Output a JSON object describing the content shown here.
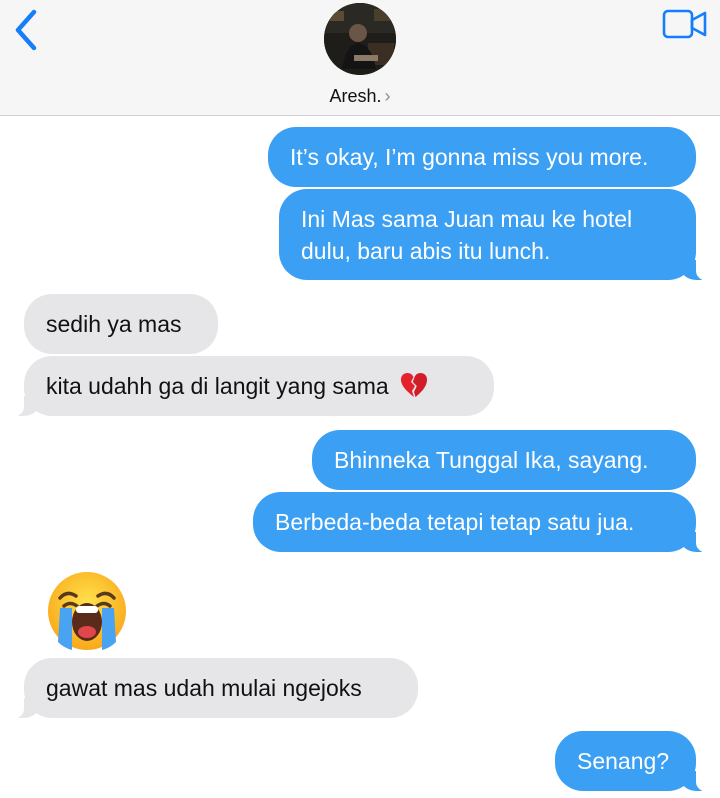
{
  "header": {
    "back_icon": "chevron-left-icon",
    "video_icon": "video-camera-icon",
    "contact_name": "Aresh.",
    "chevron": "›",
    "accent_color": "#147efb"
  },
  "messages": [
    {
      "direction": "outgoing",
      "text": "It’s okay, I’m gonna miss you more."
    },
    {
      "direction": "outgoing",
      "lines": [
        "Ini Mas sama Juan mau ke hotel",
        "dulu, baru abis itu lunch."
      ]
    },
    {
      "direction": "incoming",
      "text": "sedih ya mas"
    },
    {
      "direction": "incoming",
      "text": "kita udahh ga di langit yang sama",
      "emoji": "broken-heart-icon"
    },
    {
      "direction": "outgoing",
      "text": "Bhinneka Tunggal Ika, sayang."
    },
    {
      "direction": "outgoing",
      "text": "Berbeda-beda tetapi tetap satu jua."
    },
    {
      "direction": "incoming",
      "emoji_only": "loudly-crying-face-icon"
    },
    {
      "direction": "incoming",
      "text": "gawat mas udah mulai ngejoks"
    },
    {
      "direction": "outgoing",
      "text": "Senang?"
    }
  ],
  "colors": {
    "outgoing_bubble": "#3b9ff3",
    "incoming_bubble": "#e6e6e9",
    "header_background": "#f6f6f6"
  }
}
